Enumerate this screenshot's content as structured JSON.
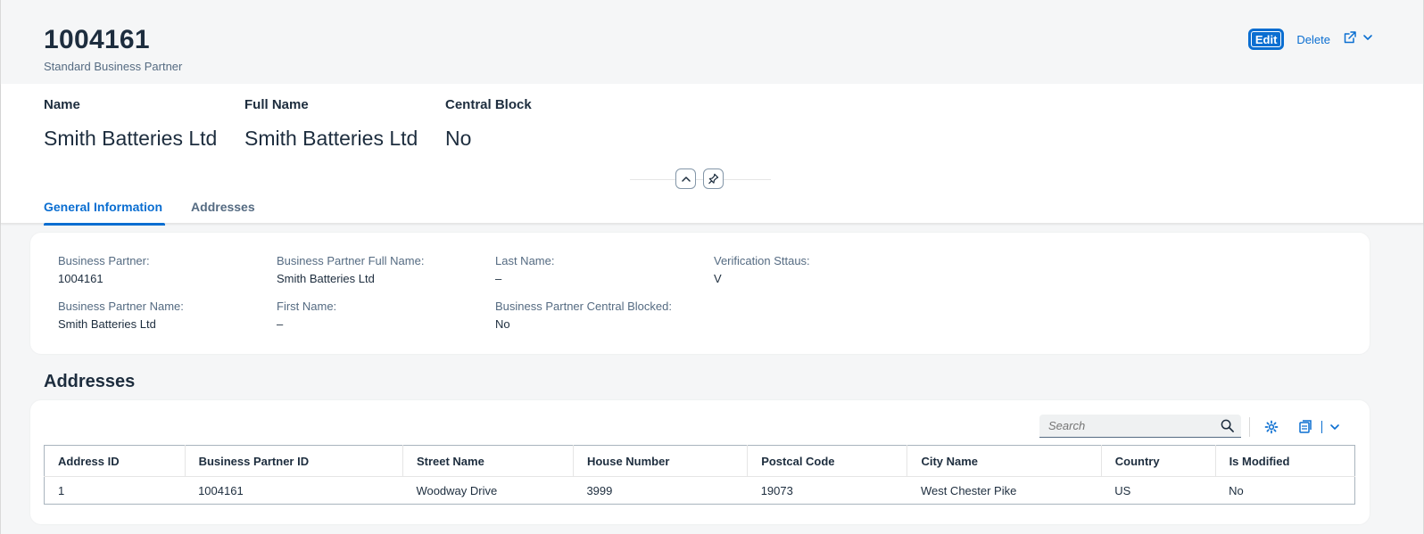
{
  "header": {
    "title": "1004161",
    "subtitle": "Standard Business Partner",
    "actions": {
      "edit": "Edit",
      "delete": "Delete"
    }
  },
  "kpis": [
    {
      "label": "Name",
      "value": "Smith Batteries Ltd"
    },
    {
      "label": "Full Name",
      "value": "Smith Batteries Ltd"
    },
    {
      "label": "Central Block",
      "value": "No"
    }
  ],
  "tabs": [
    {
      "label": "General Information",
      "active": true
    },
    {
      "label": "Addresses",
      "active": false
    }
  ],
  "general": {
    "business_partner": {
      "label": "Business Partner:",
      "value": "1004161"
    },
    "business_partner_name": {
      "label": "Business Partner Name:",
      "value": "Smith Batteries Ltd"
    },
    "full_name": {
      "label": "Business Partner Full Name:",
      "value": "Smith Batteries Ltd"
    },
    "first_name": {
      "label": "First Name:",
      "value": "–"
    },
    "last_name": {
      "label": "Last Name:",
      "value": "–"
    },
    "central_blocked": {
      "label": "Business Partner Central Blocked:",
      "value": "No"
    },
    "verification": {
      "label": "Verification Sttaus:",
      "value": "V"
    }
  },
  "addresses": {
    "title": "Addresses",
    "search_placeholder": "Search",
    "columns": [
      "Address ID",
      "Business Partner ID",
      "Street Name",
      "House Number",
      "Postcal Code",
      "City Name",
      "Country",
      "Is Modified"
    ],
    "rows": [
      [
        "1",
        "1004161",
        "Woodway Drive",
        "3999",
        "19073",
        "West Chester Pike",
        "US",
        "No"
      ]
    ]
  },
  "colors": {
    "accent": "#0a6ed1",
    "text": "#1d2d3e",
    "muted": "#556b82",
    "page_bg": "#f5f6f7"
  },
  "icons": [
    "share-icon",
    "chevron-down-icon",
    "collapse-header-icon",
    "pin-icon",
    "search-icon",
    "settings-icon",
    "export-icon"
  ]
}
